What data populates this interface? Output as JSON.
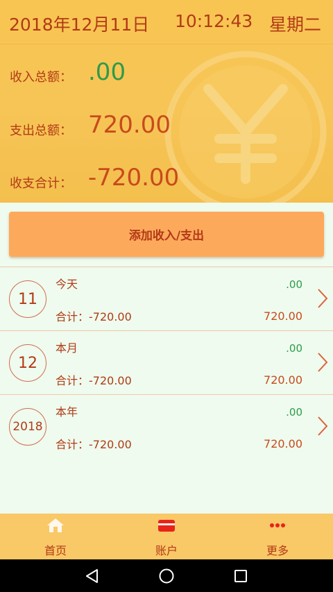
{
  "header": {
    "date": "2018年12月11日",
    "time": "10:12:43",
    "weekday": "星期二"
  },
  "summary": {
    "income_label": "收入总额：",
    "income_value": ".00",
    "expense_label": "支出总额：",
    "expense_value": "720.00",
    "net_label": "收支合计：",
    "net_value": "-720.00"
  },
  "actions": {
    "add_label": "添加收入/支出"
  },
  "periods": [
    {
      "badge": "11",
      "label": "今天",
      "total": "合计：-720.00",
      "income": ".00",
      "expense": "720.00"
    },
    {
      "badge": "12",
      "label": "本月",
      "total": "合计：-720.00",
      "income": ".00",
      "expense": "720.00"
    },
    {
      "badge": "2018",
      "label": "本年",
      "total": "合计：-720.00",
      "income": ".00",
      "expense": "720.00"
    }
  ],
  "nav": {
    "items": [
      {
        "label": "首页",
        "icon": "home-icon"
      },
      {
        "label": "账户",
        "icon": "wallet-icon"
      },
      {
        "label": "更多",
        "icon": "more-icon"
      }
    ]
  },
  "colors": {
    "header_bg": "#f6c556",
    "accent_red": "#b23a16",
    "income_green": "#2f9a4a",
    "button_orange": "#fda95c",
    "page_bg": "#eefbee"
  }
}
